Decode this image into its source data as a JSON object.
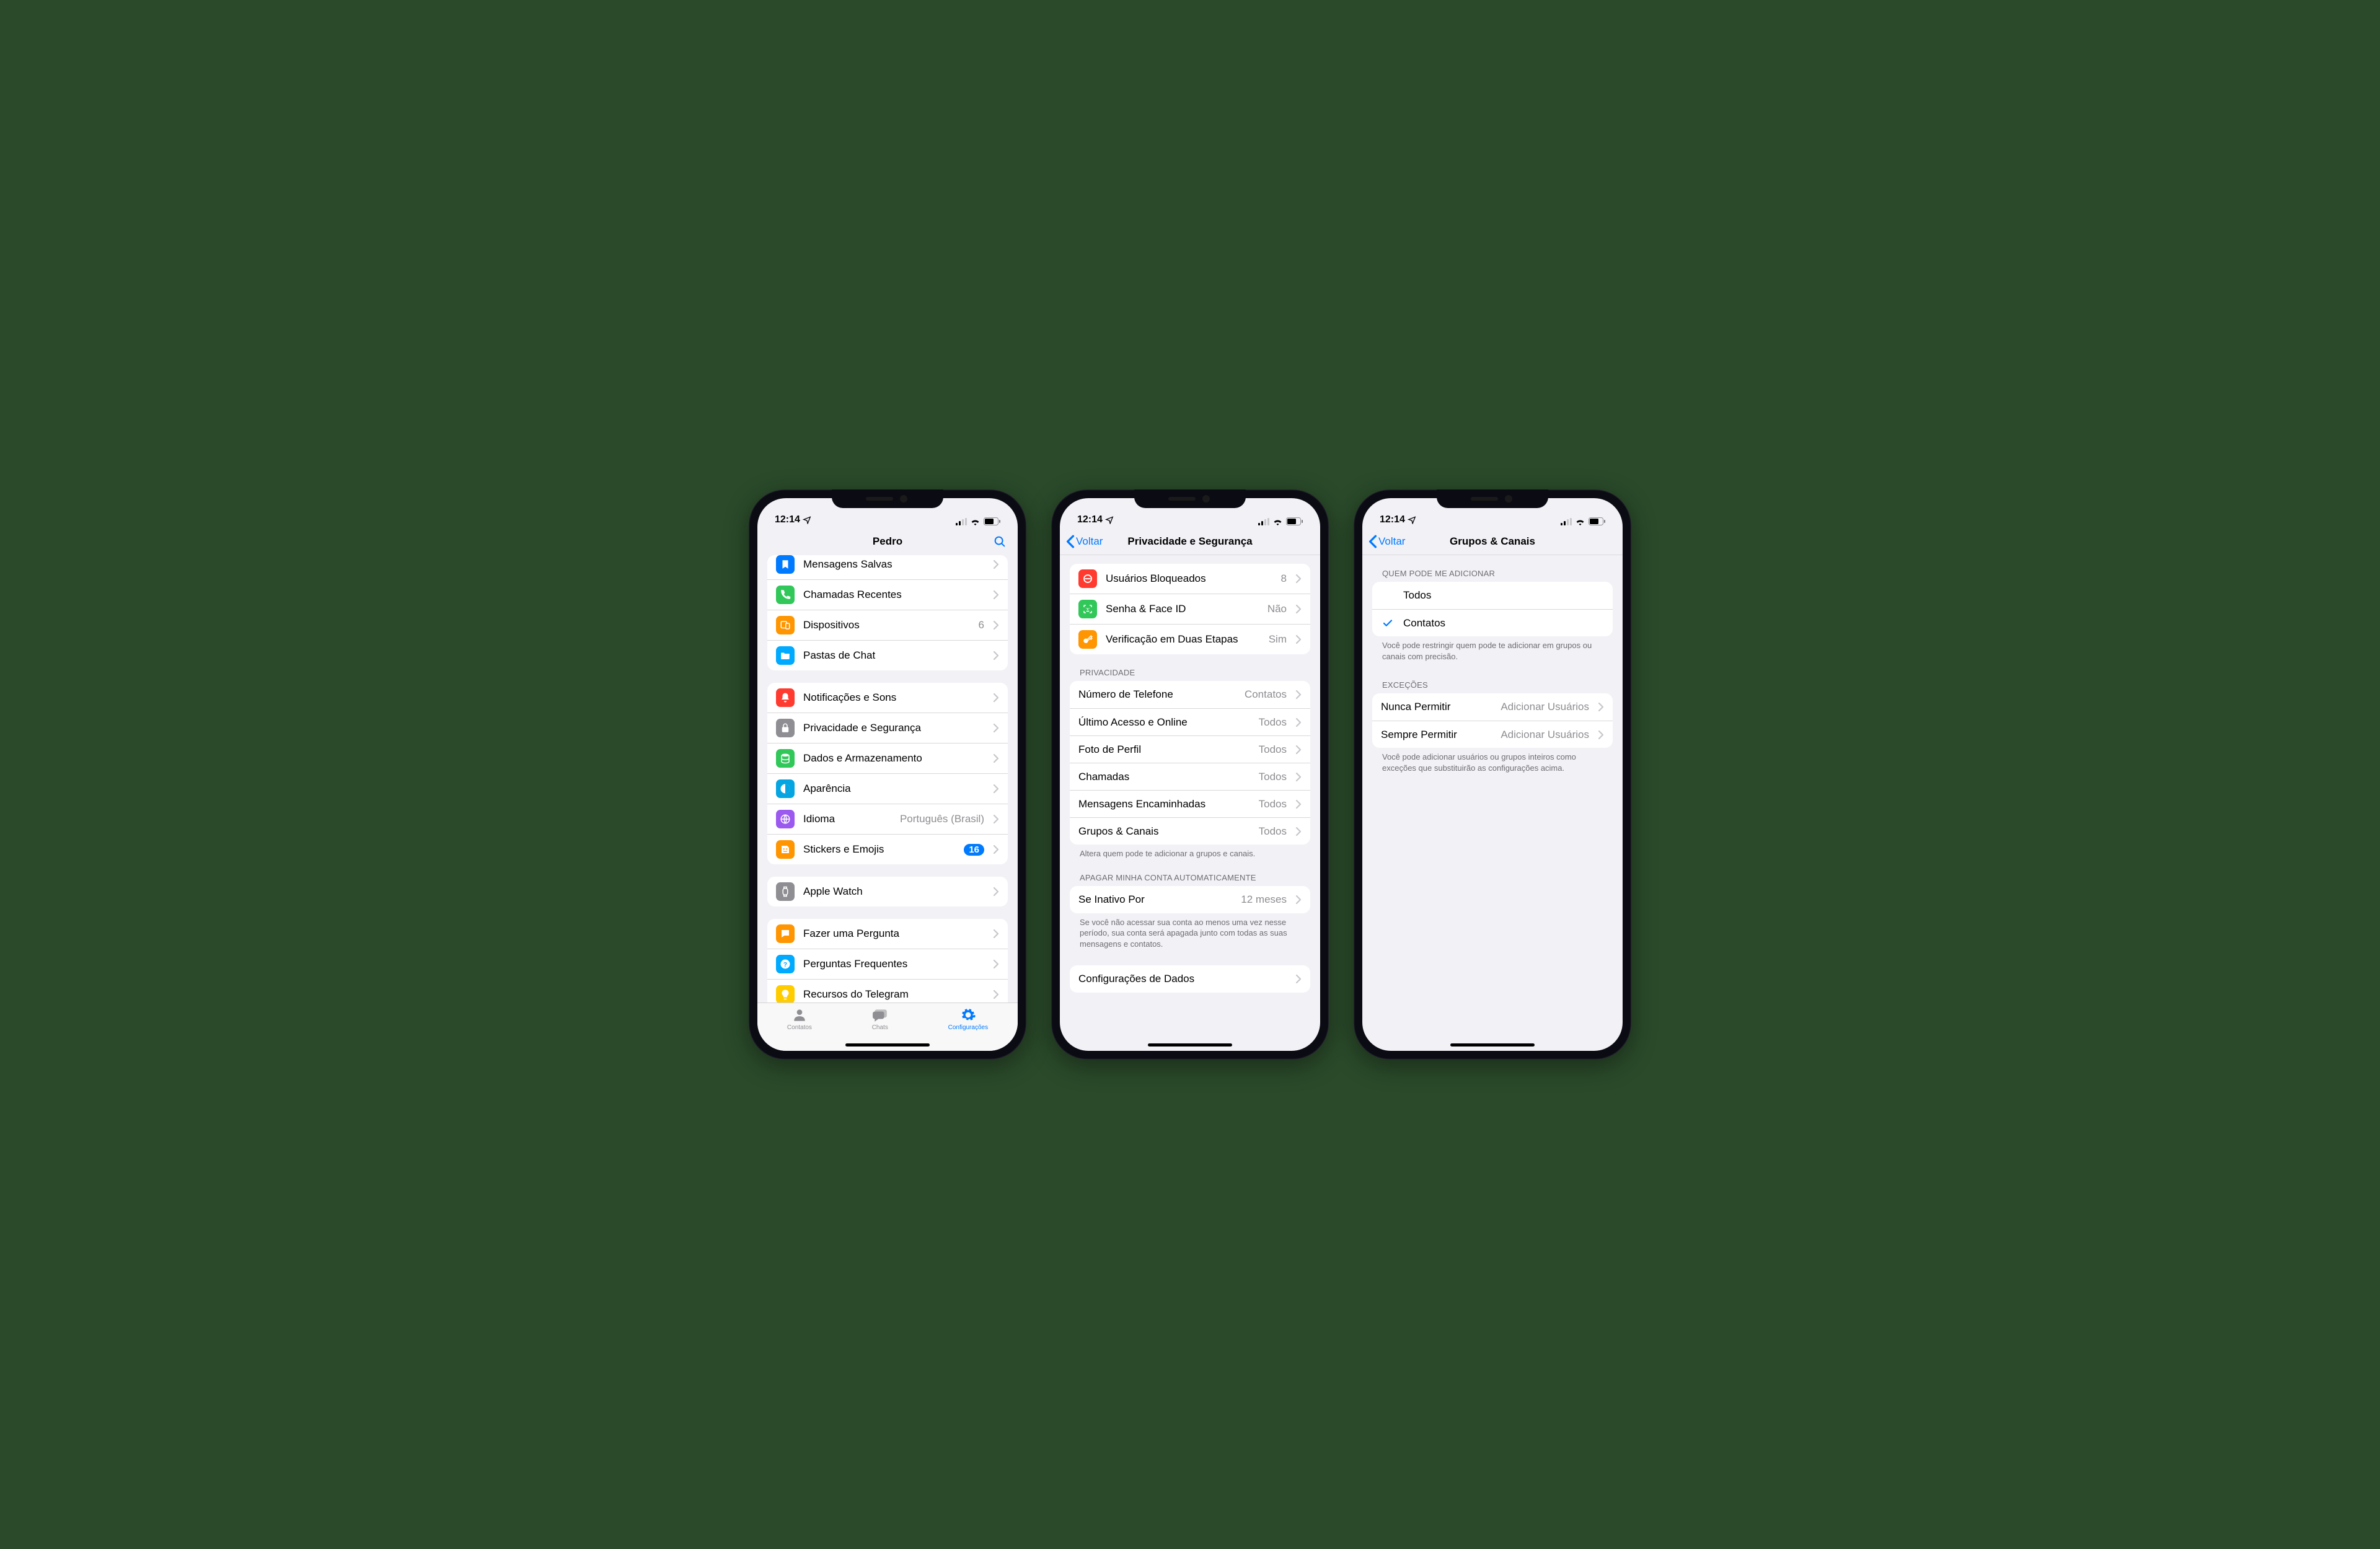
{
  "status": {
    "time": "12:14"
  },
  "phone1": {
    "title": "Pedro",
    "group1": [
      {
        "icon": "bookmark",
        "bg": "#007aff",
        "label": "Mensagens Salvas",
        "partial": true
      },
      {
        "icon": "phone",
        "bg": "#31c759",
        "label": "Chamadas Recentes"
      },
      {
        "icon": "devices",
        "bg": "#ff9500",
        "label": "Dispositivos",
        "value": "6"
      },
      {
        "icon": "folder",
        "bg": "#00aaff",
        "label": "Pastas de Chat"
      }
    ],
    "group2": [
      {
        "icon": "bell",
        "bg": "#ff3b30",
        "label": "Notificações e Sons"
      },
      {
        "icon": "lock",
        "bg": "#8e8e93",
        "label": "Privacidade e Segurança"
      },
      {
        "icon": "db",
        "bg": "#31c759",
        "label": "Dados e Armazenamento"
      },
      {
        "icon": "circle",
        "bg": "#04a5e1",
        "label": "Aparência"
      },
      {
        "icon": "globe",
        "bg": "#9b59ef",
        "label": "Idioma",
        "value": "Português (Brasil)"
      },
      {
        "icon": "sticker",
        "bg": "#ff9500",
        "label": "Stickers e Emojis",
        "badge": "16"
      }
    ],
    "group3": [
      {
        "icon": "watch",
        "bg": "#8e8e93",
        "label": "Apple Watch"
      }
    ],
    "group4": [
      {
        "icon": "chat",
        "bg": "#ff9500",
        "label": "Fazer uma Pergunta"
      },
      {
        "icon": "qmark",
        "bg": "#00aaff",
        "label": "Perguntas Frequentes"
      },
      {
        "icon": "bulb",
        "bg": "#ffcc00",
        "label": "Recursos do Telegram",
        "partial_bottom": true
      }
    ],
    "tabs": {
      "contacts": "Contatos",
      "chats": "Chats",
      "settings": "Configurações"
    }
  },
  "phone2": {
    "back": "Voltar",
    "title": "Privacidade e Segurança",
    "sec1": [
      {
        "icon": "block",
        "bg": "#ff3b30",
        "label": "Usuários Bloqueados",
        "value": "8"
      },
      {
        "icon": "faceid",
        "bg": "#31c759",
        "label": "Senha & Face ID",
        "value": "Não"
      },
      {
        "icon": "key",
        "bg": "#ff9500",
        "label": "Verificação em Duas Etapas",
        "value": "Sim"
      }
    ],
    "privacy_header": "PRIVACIDADE",
    "sec2": [
      {
        "label": "Número de Telefone",
        "value": "Contatos"
      },
      {
        "label": "Último Acesso e Online",
        "value": "Todos"
      },
      {
        "label": "Foto de Perfil",
        "value": "Todos"
      },
      {
        "label": "Chamadas",
        "value": "Todos"
      },
      {
        "label": "Mensagens Encaminhadas",
        "value": "Todos"
      },
      {
        "label": "Grupos & Canais",
        "value": "Todos"
      }
    ],
    "privacy_footer": "Altera quem pode te adicionar a grupos e canais.",
    "delete_header": "APAGAR MINHA CONTA AUTOMATICAMENTE",
    "sec3": {
      "label": "Se Inativo Por",
      "value": "12 meses"
    },
    "delete_footer": "Se você não acessar sua conta ao menos uma vez nesse período, sua conta será apagada junto com todas as suas mensagens e contatos.",
    "sec4": {
      "label": "Configurações de Dados"
    }
  },
  "phone3": {
    "back": "Voltar",
    "title": "Grupos & Canais",
    "who_header": "QUEM PODE ME ADICIONAR",
    "opts": [
      {
        "label": "Todos",
        "checked": false
      },
      {
        "label": "Contatos",
        "checked": true
      }
    ],
    "who_footer": "Você pode restringir quem pode te adicionar em grupos ou canais com precisão.",
    "exc_header": "EXCEÇÕES",
    "exc": [
      {
        "label": "Nunca Permitir",
        "value": "Adicionar Usuários"
      },
      {
        "label": "Sempre Permitir",
        "value": "Adicionar Usuários"
      }
    ],
    "exc_footer": "Você pode adicionar usuários ou grupos inteiros como exceções que substituirão as configurações acima."
  }
}
